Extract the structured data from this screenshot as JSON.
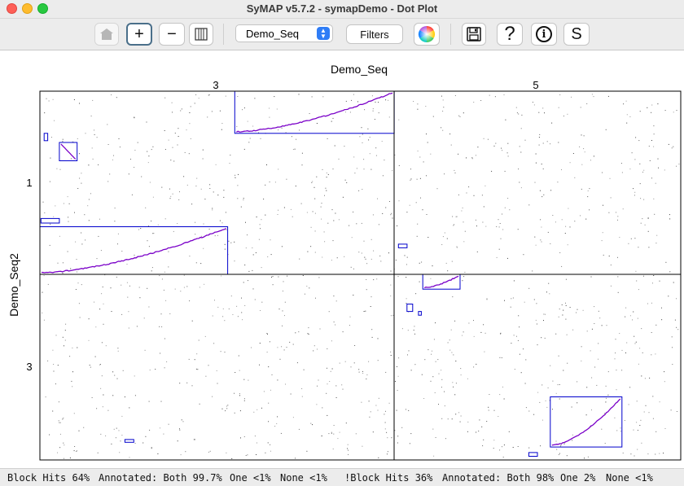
{
  "window": {
    "title": "SyMAP v5.7.2 - symapDemo - Dot Plot"
  },
  "toolbar": {
    "home_icon": "home-icon",
    "zoom_in_label": "+",
    "zoom_out_label": "−",
    "scale_icon": "scale-icon",
    "project_select": "Demo_Seq",
    "filters_label": "Filters",
    "color_icon": "color-wheel-icon",
    "save_icon": "save-icon",
    "help_label": "?",
    "info_label": "i",
    "stats_label": "S"
  },
  "chart_data": {
    "type": "scatter",
    "title": "",
    "xlabel": "Demo_Seq",
    "ylabel": "Demo_Seq2",
    "x_chromosomes": [
      "3",
      "5"
    ],
    "y_chromosomes": [
      "1",
      "3"
    ],
    "grid": true,
    "blocks": [
      {
        "x": "3",
        "y": "1",
        "x_range": [
          0.55,
          1.0
        ],
        "y_range": [
          0.77,
          1.0
        ],
        "orientation": "forward"
      },
      {
        "x": "3",
        "y": "1",
        "x_range": [
          0.0,
          0.53
        ],
        "y_range": [
          0.0,
          0.26
        ],
        "orientation": "forward"
      },
      {
        "x": "3",
        "y": "1",
        "x_range": [
          0.055,
          0.105
        ],
        "y_range": [
          0.62,
          0.72
        ],
        "orientation": "reverse"
      },
      {
        "x": "3",
        "y": "1",
        "x_range": [
          0.012,
          0.022
        ],
        "y_range": [
          0.73,
          0.77
        ],
        "orientation": "forward"
      },
      {
        "x": "3",
        "y": "1",
        "x_range": [
          0.003,
          0.055
        ],
        "y_range": [
          0.28,
          0.305
        ],
        "orientation": "forward"
      },
      {
        "x": "5",
        "y": "1",
        "x_range": [
          0.015,
          0.045
        ],
        "y_range": [
          0.145,
          0.165
        ],
        "orientation": "forward"
      },
      {
        "x": "5",
        "y": "3",
        "x_range": [
          0.1,
          0.23
        ],
        "y_range": [
          0.92,
          1.0
        ],
        "orientation": "forward"
      },
      {
        "x": "5",
        "y": "3",
        "x_range": [
          0.045,
          0.065
        ],
        "y_range": [
          0.8,
          0.84
        ],
        "orientation": "forward"
      },
      {
        "x": "5",
        "y": "3",
        "x_range": [
          0.085,
          0.095
        ],
        "y_range": [
          0.78,
          0.8
        ],
        "orientation": "forward"
      },
      {
        "x": "5",
        "y": "3",
        "x_range": [
          0.545,
          0.795
        ],
        "y_range": [
          0.07,
          0.34
        ],
        "orientation": "forward"
      },
      {
        "x": "5",
        "y": "3",
        "x_range": [
          0.47,
          0.5
        ],
        "y_range": [
          0.02,
          0.04
        ],
        "orientation": "forward"
      },
      {
        "x": "3",
        "y": "3",
        "x_range": [
          0.24,
          0.265
        ],
        "y_range": [
          0.095,
          0.11
        ],
        "orientation": "forward"
      }
    ],
    "colors": {
      "block": "#0000cc",
      "hit_forward": "#7a00c8",
      "hit_scatter": "#333333",
      "grid": "#000000"
    }
  },
  "status": {
    "block_hits_1": "Block Hits 64%",
    "annotated_1": "Annotated: Both 99.7%",
    "one_1": "One <1%",
    "none_1": "None <1%",
    "block_hits_2": "!Block Hits 36%",
    "annotated_2": "Annotated: Both 98%",
    "one_2": "One 2%",
    "none_2": "None <1%"
  }
}
